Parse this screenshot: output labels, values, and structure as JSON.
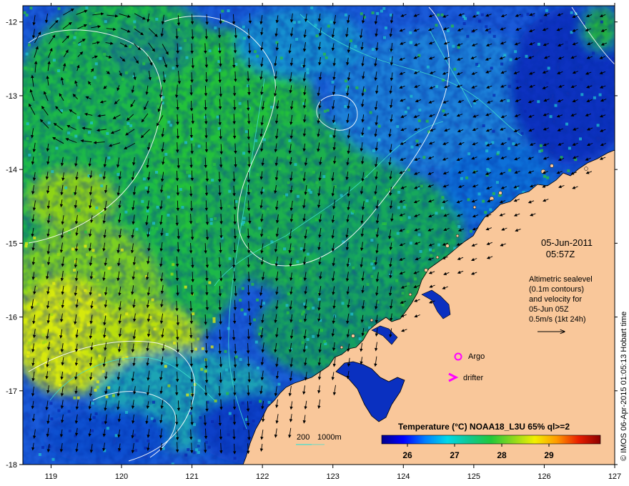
{
  "map": {
    "lon_ticks": [
      119,
      120,
      121,
      122,
      123,
      124,
      125,
      126,
      127
    ],
    "lat_ticks": [
      -12,
      -13,
      -14,
      -15,
      -16,
      -17,
      -18
    ],
    "lon_range": [
      118.6,
      127.0
    ],
    "lat_range": [
      -18.0,
      -11.78
    ]
  },
  "annotations": {
    "date": "05-Jun-2011",
    "time": "05:57Z",
    "altimetry_lines": [
      "Altimetric sealevel",
      "(0.1m contours)",
      "and velocity for",
      "05-Jun 05Z",
      "0.5m/s (1kt 24h)"
    ],
    "argo_label": "Argo",
    "drifter_label": "drifter",
    "credit": "© IMOS 06-Apr-2015 01:05:13 Hobart time",
    "depth_label_1": "200",
    "depth_label_2": "1000m"
  },
  "colorbar": {
    "title": "Temperature (°C) NOAA18_L3U 65% ql>=2",
    "ticks": [
      "26",
      "27",
      "28",
      "29"
    ],
    "stops": [
      "#00008c",
      "#0000ff",
      "#0080ff",
      "#00d8e8",
      "#10c890",
      "#22c83a",
      "#8cd81e",
      "#f2f000",
      "#ff9a00",
      "#e81e00",
      "#8c0000"
    ]
  },
  "colors": {
    "land": "#f9c79a",
    "deep_water": "#0020b8",
    "velocity_arrow": "#000000",
    "sealevel_contour": "#ffffff",
    "bathymetry_contour": "#40e0d0",
    "argo_marker": "#ff00ff"
  }
}
